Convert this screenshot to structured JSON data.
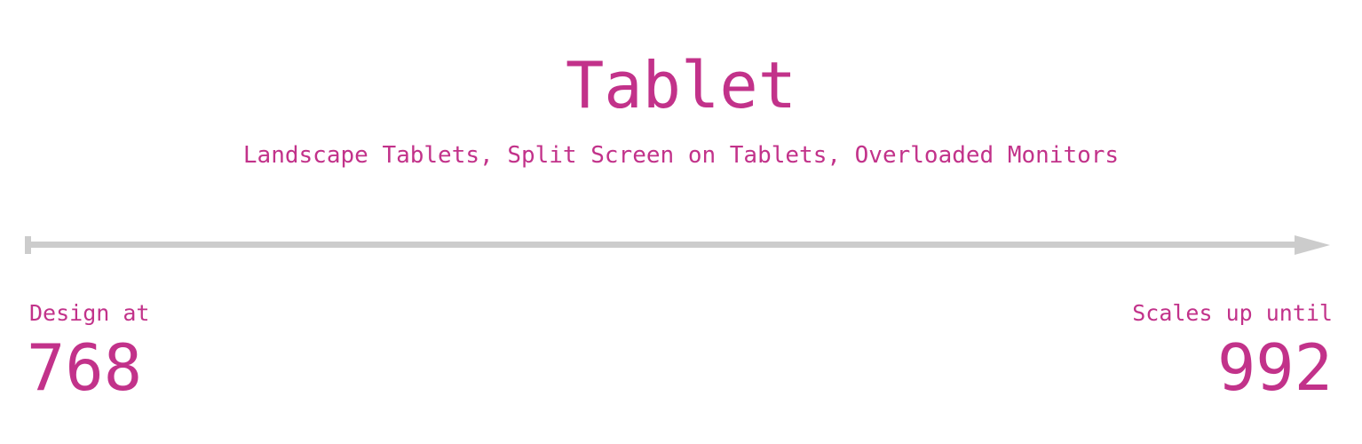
{
  "title": "Tablet",
  "subtitle": "Landscape Tablets, Split Screen on Tablets, Overloaded Monitors",
  "range": {
    "start_label": "Design at",
    "start_value": "768",
    "end_label": "Scales up until",
    "end_value": "992"
  },
  "colors": {
    "accent": "#c2328a",
    "arrow": "#cccccc"
  }
}
